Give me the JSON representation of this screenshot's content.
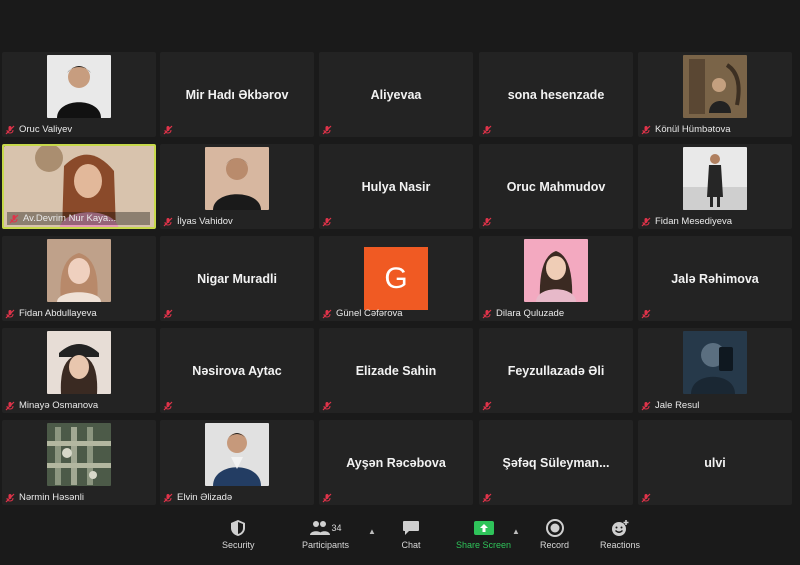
{
  "tiles": [
    {
      "name": "Oruc Valiyev",
      "type": "video",
      "photo": "p1"
    },
    {
      "name": "Mir Hadı Əkbərov",
      "type": "name"
    },
    {
      "name": "Aliyevaa",
      "type": "name"
    },
    {
      "name": "sona hesenzade",
      "type": "name"
    },
    {
      "name": "Könül Hümbətova",
      "type": "video",
      "photo": "p5"
    },
    {
      "name": "Av.Devrim Nur Kaya...",
      "type": "video",
      "photo": "p6",
      "active": true
    },
    {
      "name": "İlyas Vahidov",
      "type": "video",
      "photo": "p7"
    },
    {
      "name": "Hulya Nasir",
      "type": "name"
    },
    {
      "name": "Oruc Mahmudov",
      "type": "name"
    },
    {
      "name": "Fidan Mesediyeva",
      "type": "video",
      "photo": "p10"
    },
    {
      "name": "Fidan Abdullayeva",
      "type": "video",
      "photo": "p11"
    },
    {
      "name": "Nigar Muradli",
      "type": "name"
    },
    {
      "name": "Günel Cəfərova",
      "type": "avatar",
      "letter": "G"
    },
    {
      "name": "Dilara Quluzade",
      "type": "video",
      "photo": "p14"
    },
    {
      "name": "Jalə Rəhimova",
      "type": "name"
    },
    {
      "name": "Minayə Osmanova",
      "type": "video",
      "photo": "p16"
    },
    {
      "name": "Nəsirova Aytac",
      "type": "name"
    },
    {
      "name": "Elizade Sahin",
      "type": "name"
    },
    {
      "name": "Feyzullazadə Əli",
      "type": "name"
    },
    {
      "name": "Jale Resul",
      "type": "video",
      "photo": "p20"
    },
    {
      "name": "Nərmin Həsənli",
      "type": "video",
      "photo": "p21"
    },
    {
      "name": "Elvin Əlizadə",
      "type": "video",
      "photo": "p22"
    },
    {
      "name": "Ayşən Rəcəbova",
      "type": "name"
    },
    {
      "name": "Şəfəq  Süleyman...",
      "type": "name"
    },
    {
      "name": "ulvi",
      "type": "name"
    }
  ],
  "toolbar": {
    "security": "Security",
    "participants": "Participants",
    "participants_count": "34",
    "chat": "Chat",
    "share": "Share Screen",
    "record": "Record",
    "reactions": "Reactions"
  },
  "colors": {
    "active_border": "#c6d84a",
    "share_green": "#2fc35a",
    "avatar_orange": "#f05a23",
    "muted_red": "#e0334a"
  }
}
